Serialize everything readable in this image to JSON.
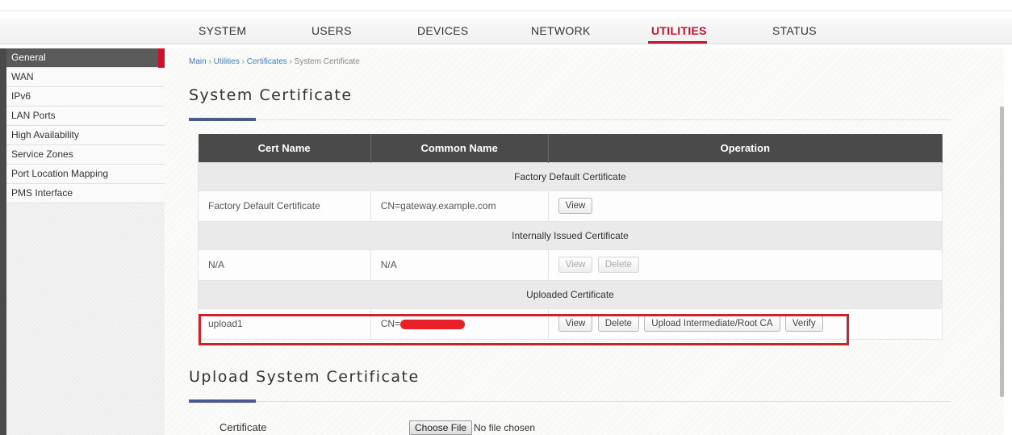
{
  "nav": {
    "items": [
      "SYSTEM",
      "USERS",
      "DEVICES",
      "NETWORK",
      "UTILITIES",
      "STATUS"
    ],
    "active": "UTILITIES",
    "accent_color": "#c8102e"
  },
  "sidebar": {
    "items": [
      {
        "label": "General"
      },
      {
        "label": "WAN"
      },
      {
        "label": "IPv6"
      },
      {
        "label": "LAN Ports"
      },
      {
        "label": "High Availability"
      },
      {
        "label": "Service Zones"
      },
      {
        "label": "Port Location Mapping"
      },
      {
        "label": "PMS Interface"
      }
    ],
    "active": "General"
  },
  "breadcrumb": {
    "main": "Main",
    "utilities": "Utilities",
    "certificates": "Certificates",
    "current": "System Certificate",
    "sep": "›"
  },
  "page": {
    "title": "System Certificate",
    "upload_title": "Upload System Certificate"
  },
  "table": {
    "headers": [
      "Cert Name",
      "Common Name",
      "Operation"
    ],
    "groups": [
      {
        "label": "Factory Default Certificate",
        "row": {
          "cert_name": "Factory Default Certificate",
          "common_name": "CN=gateway.example.com",
          "buttons": [
            "View"
          ]
        }
      },
      {
        "label": "Internally Issued Certificate",
        "row": {
          "cert_name": "N/A",
          "common_name": "N/A",
          "buttons": [
            "View",
            "Delete"
          ]
        }
      },
      {
        "label": "Uploaded Certificate",
        "row": {
          "cert_name": "upload1",
          "common_name": "CN=",
          "buttons": [
            "View",
            "Delete",
            "Upload Intermediate/Root CA",
            "Verify"
          ]
        }
      }
    ]
  },
  "upload": {
    "certificate_label": "Certificate",
    "choose_file": "Choose File",
    "file_status": "No file chosen"
  }
}
